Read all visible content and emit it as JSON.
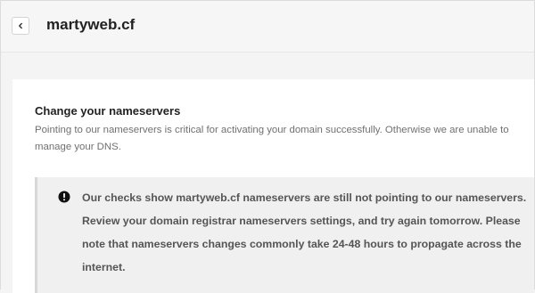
{
  "header": {
    "back_icon": "chevron-left-icon",
    "title": "martyweb.cf"
  },
  "section": {
    "title": "Change your nameservers",
    "description": "Pointing to our nameservers is critical for activating your domain successfully. Otherwise we are unable to manage your DNS."
  },
  "alert": {
    "icon": "exclamation-circle-icon",
    "message": "Our checks show martyweb.cf nameservers are still not pointing to our nameservers. Review your domain registrar nameservers settings, and try again tomorrow. Please note that nameservers changes commonly take 24-48 hours to propagate across the internet."
  }
}
